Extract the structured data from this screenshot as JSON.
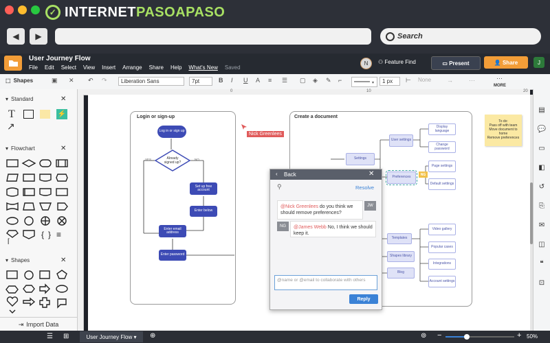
{
  "site": {
    "logo_main": "INTERNET",
    "logo_accent": "PASOAPASO",
    "logo_mark": "✓"
  },
  "browser": {
    "search_placeholder": "Search"
  },
  "app": {
    "title": "User Journey Flow",
    "menu": [
      "File",
      "Edit",
      "Select",
      "View",
      "Insert",
      "Arrange",
      "Share",
      "Help",
      "What's New",
      "Saved"
    ],
    "avatar_n": "N",
    "feature_find": "Feature Find",
    "present": "Present",
    "share": "Share",
    "avatar_j": "J"
  },
  "toolbar": {
    "shapes": "Shapes",
    "font": "Liberation Sans",
    "size": "7pt",
    "line_px": "1 px",
    "none": "None",
    "more": "MORE"
  },
  "ruler": {
    "ticks": [
      "0",
      "10",
      "20"
    ]
  },
  "left_panel": {
    "sections": [
      "Standard",
      "Flowchart",
      "Shapes"
    ],
    "import_data": "Import Data"
  },
  "diagram": {
    "panel1_title": "Login or sign-up",
    "panel2_title": "Create a document",
    "nodes": {
      "login": "Log in or sign up",
      "already": "Already signed up?",
      "yes": "YES",
      "no": "NO",
      "setup": "Set up free account",
      "enter_below": "Enter below",
      "enter_email": "Enter email address",
      "enter_password": "Enter password",
      "settings": "Settings",
      "user_settings": "User settings",
      "preferences": "Preferences",
      "display_language": "Display language",
      "change_password": "Change password",
      "page_settings": "Page settings",
      "default_settings": "Default settings",
      "templates": "Templates",
      "shapes_lib": "Shapes library",
      "blog": "Blog",
      "video_gallery": "Video gallery",
      "popular_cases": "Popular cases",
      "integrations": "Integrations",
      "account_settings": "Account settings",
      "badge": "NG"
    },
    "cursor_user": "Nick Greenlees",
    "sticky_note": "To do:\nPass off with team\nMove document to home\nRemove preferences"
  },
  "comment": {
    "back": "Back",
    "resolve": "Resolve",
    "msg1_mention": "@Nick Greenlees",
    "msg1_text": " do you think we should remove preferences?",
    "msg1_avatar": "JW",
    "msg2_mention": "@James Webb",
    "msg2_text": " No, I think we should keep it.",
    "msg2_avatar": "NG",
    "input_placeholder": "@name or @email to collaborate with others",
    "reply": "Reply"
  },
  "bottom": {
    "page_tab": "User Journey Flow",
    "zoom": "50%"
  },
  "colors": {
    "accent_orange": "#f29d38",
    "node_blue": "#3d4bb5",
    "logo_green": "#a8e063",
    "reply_blue": "#3b82d6",
    "cursor_red": "#e05a5a"
  }
}
